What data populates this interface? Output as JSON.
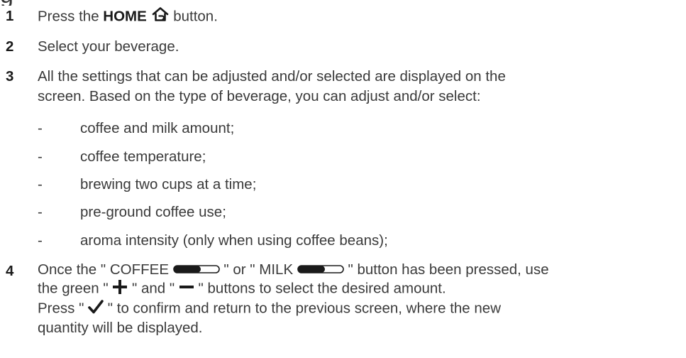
{
  "heading_fragment": "g",
  "steps": [
    {
      "number": "1",
      "text_before": "Press the ",
      "bold": "HOME",
      "icon": "home-icon",
      "text_after": " button."
    },
    {
      "number": "2",
      "text": "Select your beverage."
    },
    {
      "number": "3",
      "line1": "All the settings that can be adjusted and/or selected are displayed on the",
      "line2": "screen. Based on the type of beverage, you can adjust and/or select:",
      "items": [
        "coffee and milk amount;",
        "coffee temperature;",
        "brewing two cups at a time;",
        "pre-ground coffee use;",
        "aroma intensity (only when using coffee beans);"
      ]
    },
    {
      "number": "4",
      "l1_a": "Once the \" COFFEE ",
      "l1_b": " \" or \" MILK ",
      "l1_c": " \" button has been pressed, use",
      "l2_a": "the green \" ",
      "l2_b": " \" and \" ",
      "l2_c": " \" buttons to select the desired amount.",
      "l3_a": "Press \" ",
      "l3_b": " \" to confirm and return to the previous screen, where the new",
      "l4": "quantity will be displayed."
    }
  ],
  "icons": {
    "home": "home-icon",
    "slider": "slider-icon",
    "plus": "plus-icon",
    "minus": "minus-icon",
    "check": "check-icon"
  },
  "dash": "-"
}
